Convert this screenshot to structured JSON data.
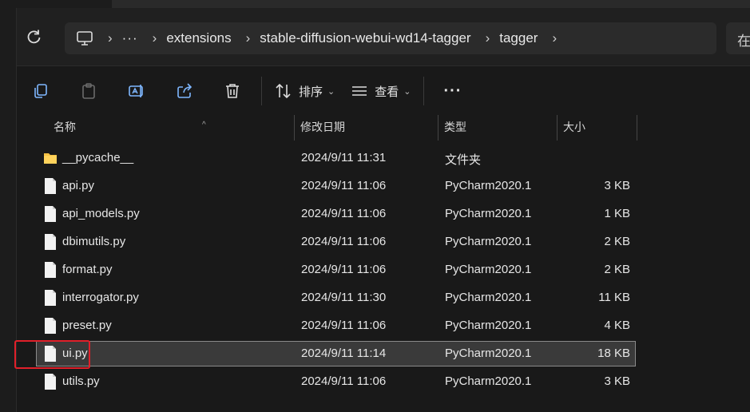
{
  "address_bar": {
    "overflow": "···",
    "separator": "›",
    "crumbs": [
      "extensions",
      "stable-diffusion-webui-wd14-tagger",
      "tagger"
    ],
    "search_partial": "在"
  },
  "toolbar": {
    "sort_label": "排序",
    "view_label": "查看",
    "more_label": "···",
    "chevron": "⌄"
  },
  "columns": {
    "name": "名称",
    "date": "修改日期",
    "type": "类型",
    "size": "大小",
    "sort_caret": "^"
  },
  "files": [
    {
      "name": "__pycache__",
      "date": "2024/9/11 11:31",
      "type": "文件夹",
      "size": "",
      "kind": "folder"
    },
    {
      "name": "api.py",
      "date": "2024/9/11 11:06",
      "type": "PyCharm2020.1",
      "size": "3 KB",
      "kind": "file"
    },
    {
      "name": "api_models.py",
      "date": "2024/9/11 11:06",
      "type": "PyCharm2020.1",
      "size": "1 KB",
      "kind": "file"
    },
    {
      "name": "dbimutils.py",
      "date": "2024/9/11 11:06",
      "type": "PyCharm2020.1",
      "size": "2 KB",
      "kind": "file"
    },
    {
      "name": "format.py",
      "date": "2024/9/11 11:06",
      "type": "PyCharm2020.1",
      "size": "2 KB",
      "kind": "file"
    },
    {
      "name": "interrogator.py",
      "date": "2024/9/11 11:30",
      "type": "PyCharm2020.1",
      "size": "11 KB",
      "kind": "file"
    },
    {
      "name": "preset.py",
      "date": "2024/9/11 11:06",
      "type": "PyCharm2020.1",
      "size": "4 KB",
      "kind": "file"
    },
    {
      "name": "ui.py",
      "date": "2024/9/11 11:14",
      "type": "PyCharm2020.1",
      "size": "18 KB",
      "kind": "file",
      "selected": true
    },
    {
      "name": "utils.py",
      "date": "2024/9/11 11:06",
      "type": "PyCharm2020.1",
      "size": "3 KB",
      "kind": "file"
    }
  ],
  "colors": {
    "folder": "#f4c144",
    "file": "#f2f2f2",
    "highlight": "#e0202a",
    "selected_bg": "#3a3a3a"
  },
  "icons": [
    "refresh-icon",
    "computer-icon",
    "copy-icon",
    "paste-icon",
    "rename-icon",
    "share-icon",
    "delete-icon",
    "sort-icon",
    "view-icon",
    "folder-icon",
    "file-icon"
  ]
}
